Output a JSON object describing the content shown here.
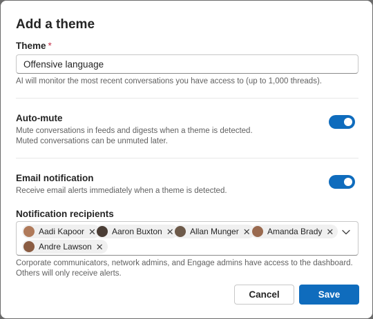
{
  "dialog": {
    "title": "Add a theme",
    "theme_label": "Theme",
    "required_marker": "*",
    "theme_value": "Offensive language",
    "theme_help": "AI will monitor the most recent conversations you have access to (up to 1,000 threads).",
    "auto_mute": {
      "label": "Auto-mute",
      "description_line1": "Mute conversations in feeds and digests when a theme is detected.",
      "description_line2": "Muted conversations can be unmuted later.",
      "enabled": true
    },
    "email_notification": {
      "label": "Email notification",
      "description": "Receive email alerts immediately when a theme is detected.",
      "enabled": true
    },
    "recipients": {
      "label": "Notification recipients",
      "people": [
        {
          "name": "Aadi Kapoor"
        },
        {
          "name": "Aaron Buxton"
        },
        {
          "name": "Allan Munger"
        },
        {
          "name": "Amanda Brady"
        },
        {
          "name": "Andre Lawson"
        }
      ],
      "help_line1": "Corporate communicators, network admins, and Engage admins have access to the dashboard.",
      "help_line2": "Others will only receive alerts."
    },
    "buttons": {
      "cancel": "Cancel",
      "save": "Save"
    },
    "colors": {
      "accent": "#0f6cbd",
      "required": "#c4314b"
    }
  }
}
